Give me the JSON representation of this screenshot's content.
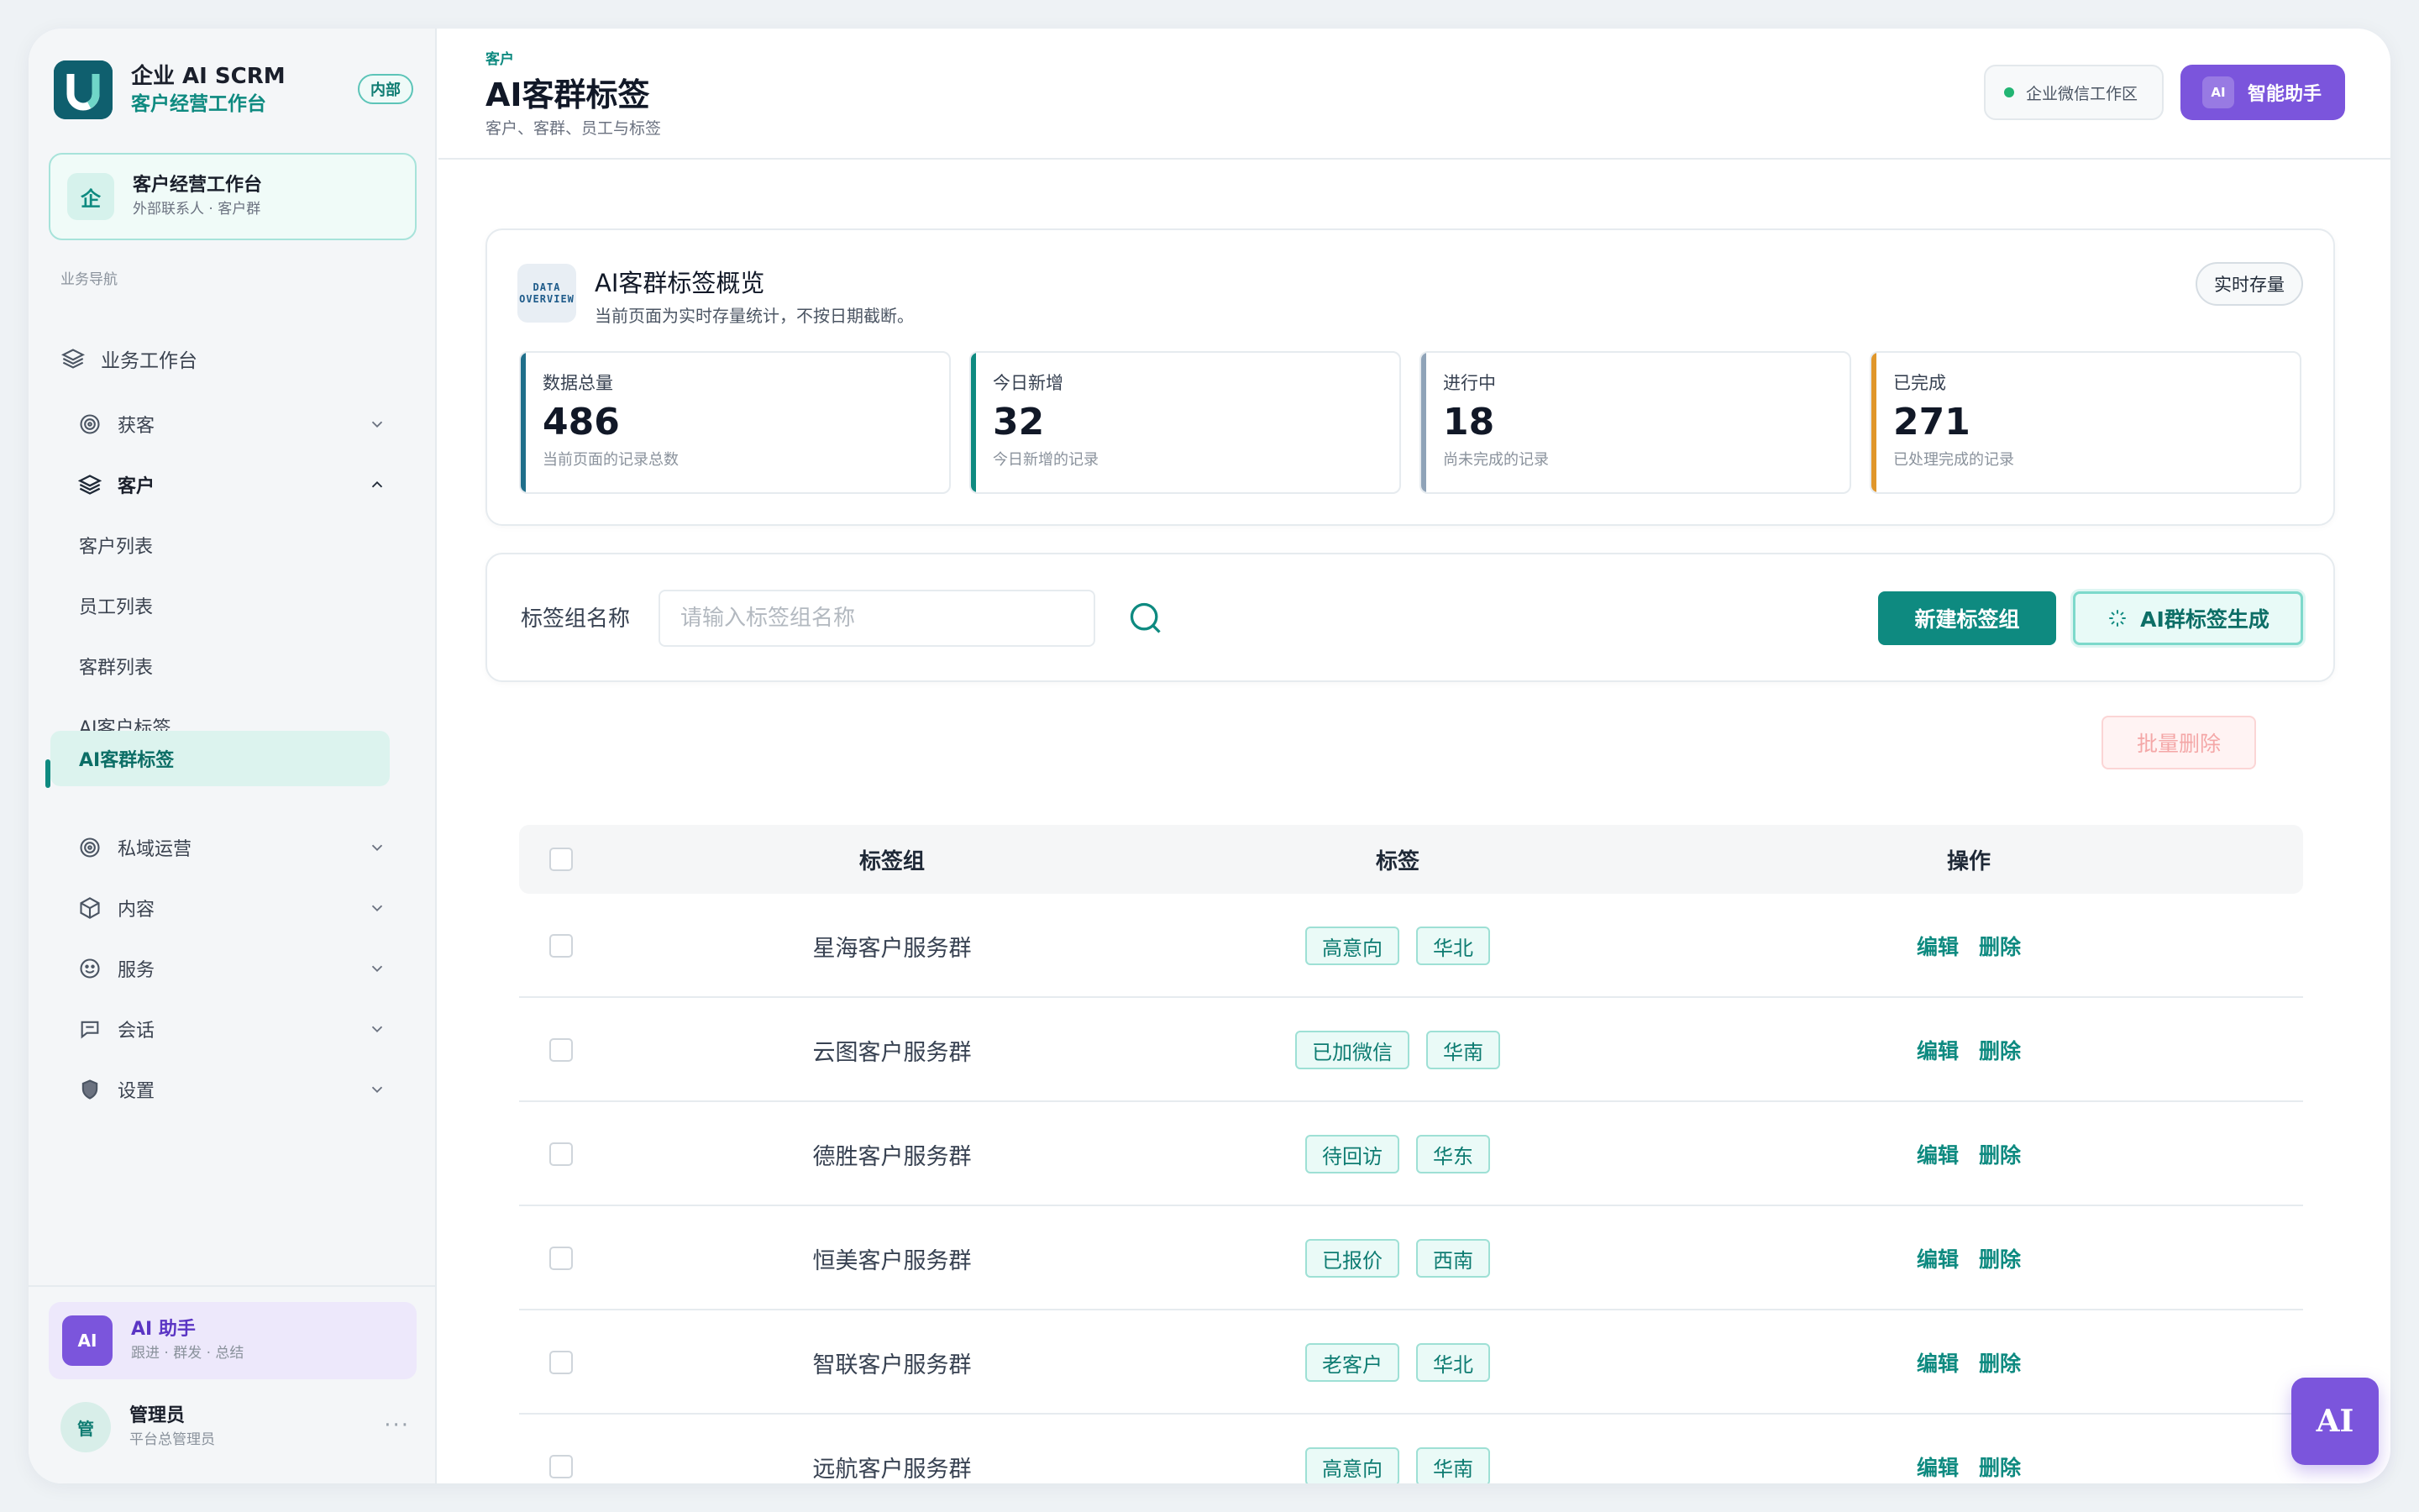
{
  "brand": {
    "title": "企业 AI SCRM",
    "subtitle": "客户经营工作台",
    "badge": "内部"
  },
  "workspace": {
    "icon_text": "企",
    "title": "客户经营工作台",
    "subtitle": "外部联系人 · 客户群"
  },
  "sidebar": {
    "section_label": "业务导航",
    "items": [
      {
        "label": "业务工作台",
        "icon": "layers-icon"
      },
      {
        "label": "获客",
        "icon": "target-icon",
        "expanded": false
      },
      {
        "label": "客户",
        "icon": "layers-icon",
        "expanded": true
      },
      {
        "label": "客户列表"
      },
      {
        "label": "员工列表"
      },
      {
        "label": "客群列表"
      },
      {
        "label": "AI客户标签"
      },
      {
        "label": "AI客群标签",
        "active": true
      },
      {
        "label": "私域运营",
        "icon": "target-icon",
        "expanded": false
      },
      {
        "label": "内容",
        "icon": "cube-icon",
        "expanded": false
      },
      {
        "label": "服务",
        "icon": "smile-icon",
        "expanded": false
      },
      {
        "label": "会话",
        "icon": "chat-icon",
        "expanded": false
      },
      {
        "label": "设置",
        "icon": "shield-icon",
        "expanded": false
      }
    ]
  },
  "ai_assistant": {
    "avatar": "AI",
    "title": "AI 助手",
    "subtitle": "跟进 · 群发 · 总结"
  },
  "user": {
    "avatar": "管",
    "name": "管理员",
    "role": "平台总管理员",
    "more": "···"
  },
  "header": {
    "breadcrumb": "客户",
    "title": "AI客群标签",
    "subtitle": "客户、客群、员工与标签",
    "env_label": "企业微信工作区",
    "ai_button_tag": "AI",
    "ai_button_label": "智能助手"
  },
  "overview": {
    "icon_line1": "DATA",
    "icon_line2": "OVERVIEW",
    "title": "AI客群标签概览",
    "description": "当前页面为实时存量统计，不按日期截断。",
    "pill": "实时存量",
    "stats": [
      {
        "label": "数据总量",
        "value": "486",
        "note": "当前页面的记录总数",
        "color": "#1f6f8b"
      },
      {
        "label": "今日新增",
        "value": "32",
        "note": "今日新增的记录",
        "color": "#0e8a80"
      },
      {
        "label": "进行中",
        "value": "18",
        "note": "尚未完成的记录",
        "color": "#8fa3b8"
      },
      {
        "label": "已完成",
        "value": "271",
        "note": "已处理完成的记录",
        "color": "#e0962a"
      }
    ]
  },
  "filter": {
    "label": "标签组名称",
    "placeholder": "请输入标签组名称",
    "value": "",
    "new_button": "新建标签组",
    "ai_button": "AI群标签生成"
  },
  "batch_delete": "批量删除",
  "table": {
    "headers": [
      "标签组",
      "标签",
      "操作"
    ],
    "rows": [
      {
        "group": "星海客户服务群",
        "tags": [
          "高意向",
          "华北"
        ]
      },
      {
        "group": "云图客户服务群",
        "tags": [
          "已加微信",
          "华南"
        ]
      },
      {
        "group": "德胜客户服务群",
        "tags": [
          "待回访",
          "华东"
        ]
      },
      {
        "group": "恒美客户服务群",
        "tags": [
          "已报价",
          "西南"
        ]
      },
      {
        "group": "智联客户服务群",
        "tags": [
          "老客户",
          "华北"
        ]
      },
      {
        "group": "远航客户服务群",
        "tags": [
          "高意向",
          "华南"
        ]
      }
    ],
    "edit_label": "编辑",
    "delete_label": "删除"
  },
  "fab_label": "AI",
  "colors": {
    "primary": "#0e8a80",
    "ai_purple": "#7b55dc",
    "danger_light": "#f4a7a7"
  }
}
